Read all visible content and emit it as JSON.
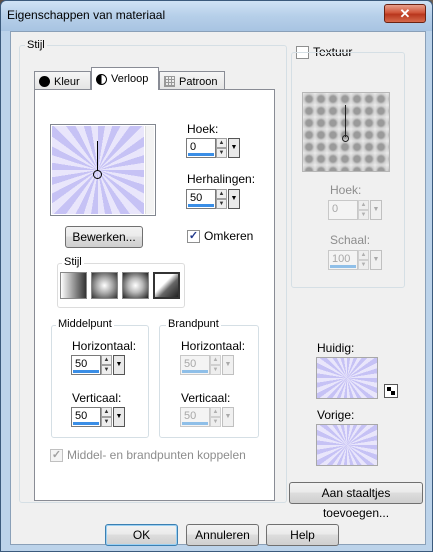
{
  "window": {
    "title": "Eigenschappen van materiaal",
    "close_glyph": "✕"
  },
  "stijl_group": {
    "label": "Stijl"
  },
  "tabs": [
    {
      "label": "Kleur",
      "icon": "circle-icon"
    },
    {
      "label": "Verloop",
      "icon": "half-circle-icon"
    },
    {
      "label": "Patroon",
      "icon": "pattern-icon"
    }
  ],
  "gradient": {
    "edit_button": "Bewerken...",
    "hoek_label": "Hoek:",
    "hoek_value": "0",
    "herhalingen_label": "Herhalingen:",
    "herhalingen_value": "50",
    "reverse_label": "Omkeren",
    "reverse_checked": true,
    "style_label": "Stijl",
    "colors": {
      "light": "#e9e6fb",
      "dark": "#c6c2f5"
    }
  },
  "middelpunt": {
    "label": "Middelpunt",
    "horizontaal_label": "Horizontaal:",
    "horizontaal_value": "50",
    "verticaal_label": "Verticaal:",
    "verticaal_value": "50"
  },
  "brandpunt": {
    "label": "Brandpunt",
    "horizontaal_label": "Horizontaal:",
    "horizontaal_value": "50",
    "verticaal_label": "Verticaal:",
    "verticaal_value": "50"
  },
  "link_label": "Middel- en brandpunten koppelen",
  "texture": {
    "label": "Textuur",
    "hoek_label": "Hoek:",
    "hoek_value": "0",
    "schaal_label": "Schaal:",
    "schaal_value": "100"
  },
  "preview": {
    "current_label": "Huidig:",
    "previous_label": "Vorige:"
  },
  "add_swatch_button": "Aan staaltjes toevoegen...",
  "footer": {
    "ok": "OK",
    "cancel": "Annuleren",
    "help": "Help"
  },
  "arrows": {
    "up": "▲",
    "down": "▼"
  }
}
